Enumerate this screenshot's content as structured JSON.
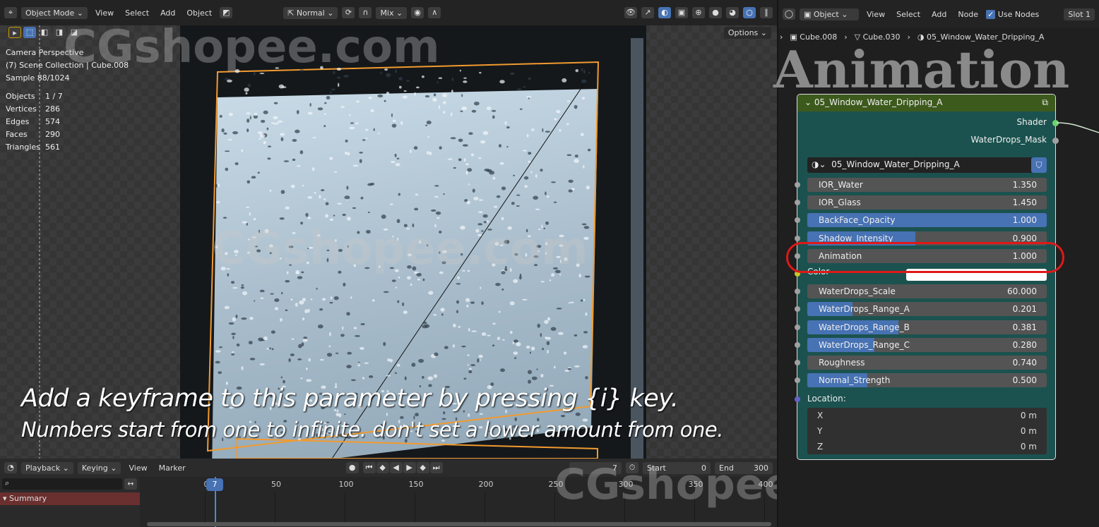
{
  "viewport_header": {
    "mode": "Object Mode",
    "menus": [
      "View",
      "Select",
      "Add",
      "Object"
    ],
    "orientation": "Normal",
    "blend": "Mix",
    "options": "Options"
  },
  "overlay": {
    "camera": "Camera Perspective",
    "collection": "(7) Scene Collection | Cube.008",
    "sample": "Sample 88/1024",
    "stats": [
      [
        "Objects",
        "1 / 7"
      ],
      [
        "Vertices",
        "286"
      ],
      [
        "Edges",
        "574"
      ],
      [
        "Faces",
        "290"
      ],
      [
        "Triangles",
        "561"
      ]
    ]
  },
  "caption": {
    "line1": "Add a keyframe to this parameter by pressing {i} key.",
    "line2": "Numbers start from one to infinite. don't set a lower amount from one."
  },
  "watermark": "CGshopee.com",
  "title_overlay": "Animation",
  "node_header": {
    "mode": "Object",
    "menus": [
      "View",
      "Select",
      "Add",
      "Node"
    ],
    "use_nodes": "Use Nodes",
    "slot": "Slot 1",
    "breadcrumb": [
      "Cube.008",
      "Cube.030",
      "05_Window_Water_Dripping_A"
    ]
  },
  "node": {
    "title": "05_Window_Water_Dripping_A",
    "outputs": [
      "Shader",
      "WaterDrops_Mask"
    ],
    "material": "05_Window_Water_Dripping_A",
    "inputs": [
      {
        "label": "IOR_Water",
        "value": "1.350",
        "fill": 0
      },
      {
        "label": "IOR_Glass",
        "value": "1.450",
        "fill": 0
      },
      {
        "label": "BackFace_Opacity",
        "value": "1.000",
        "fill": 1
      },
      {
        "label": "Shadow_Intensity",
        "value": "0.900",
        "fill": 0.45
      },
      {
        "label": "Animation",
        "value": "1.000",
        "fill": 0
      },
      {
        "label": "Color",
        "value": "",
        "color": "#ffffff"
      },
      {
        "label": "WaterDrops_Scale",
        "value": "60.000",
        "fill": 0
      },
      {
        "label": "WaterDrops_Range_A",
        "value": "0.201",
        "fill": 0.19
      },
      {
        "label": "WaterDrops_Range_B",
        "value": "0.381",
        "fill": 0.38
      },
      {
        "label": "WaterDrops_Range_C",
        "value": "0.280",
        "fill": 0.28
      },
      {
        "label": "Roughness",
        "value": "0.740",
        "fill": 0
      },
      {
        "label": "Normal_Strength",
        "value": "0.500",
        "fill": 0.25
      }
    ],
    "location_label": "Location:",
    "location": [
      {
        "label": "X",
        "value": "0 m"
      },
      {
        "label": "Y",
        "value": "0 m"
      },
      {
        "label": "Z",
        "value": "0 m"
      }
    ]
  },
  "timeline": {
    "menus": [
      "Playback",
      "Keying",
      "View",
      "Marker"
    ],
    "current_frame": "7",
    "start_label": "Start",
    "start": "0",
    "end_label": "End",
    "end": "300",
    "ticks": [
      "0",
      "50",
      "100",
      "150",
      "200",
      "250",
      "300",
      "350",
      "400"
    ],
    "summary": "Summary"
  }
}
